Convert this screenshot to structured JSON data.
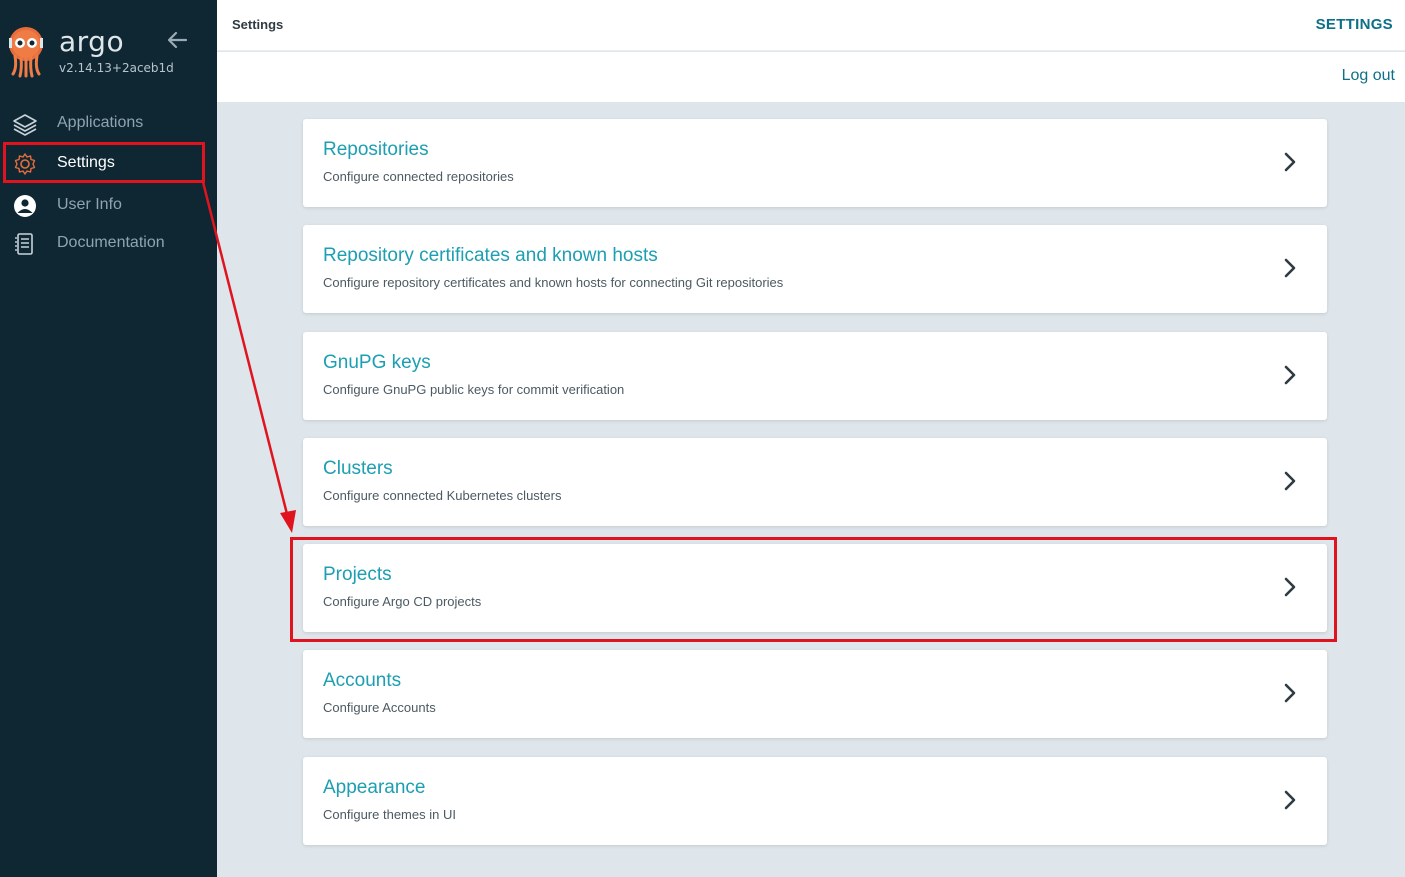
{
  "app": {
    "name": "argo",
    "version": "v2.14.13+2aceb1d"
  },
  "sidebar": {
    "items": [
      {
        "label": "Applications",
        "icon": "layers-icon"
      },
      {
        "label": "Settings",
        "icon": "gear-icon"
      },
      {
        "label": "User Info",
        "icon": "user-icon"
      },
      {
        "label": "Documentation",
        "icon": "document-icon"
      }
    ]
  },
  "header": {
    "breadcrumb": "Settings",
    "title": "SETTINGS",
    "logout_label": "Log out"
  },
  "cards": [
    {
      "title": "Repositories",
      "description": "Configure connected repositories"
    },
    {
      "title": "Repository certificates and known hosts",
      "description": "Configure repository certificates and known hosts for connecting Git repositories"
    },
    {
      "title": "GnuPG keys",
      "description": "Configure GnuPG public keys for commit verification"
    },
    {
      "title": "Clusters",
      "description": "Configure connected Kubernetes clusters"
    },
    {
      "title": "Projects",
      "description": "Configure Argo CD projects"
    },
    {
      "title": "Accounts",
      "description": "Configure Accounts"
    },
    {
      "title": "Appearance",
      "description": "Configure themes in UI"
    }
  ],
  "colors": {
    "sidebar_bg": "#0f2733",
    "accent": "#1c9eb3",
    "annotation": "#e0141e"
  }
}
